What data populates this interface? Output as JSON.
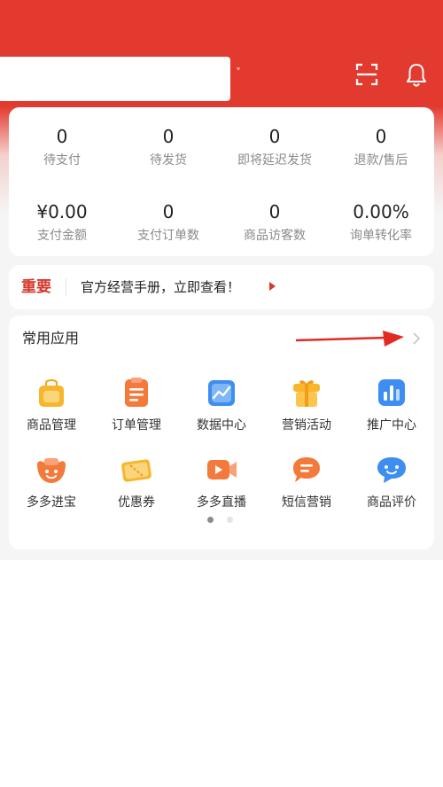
{
  "header": {
    "shop_name": "",
    "caret": "˅"
  },
  "stats": [
    {
      "value": "0",
      "label": "待支付"
    },
    {
      "value": "0",
      "label": "待发货"
    },
    {
      "value": "0",
      "label": "即将延迟发货"
    },
    {
      "value": "0",
      "label": "退款/售后"
    },
    {
      "value": "¥0.00",
      "label": "支付金额"
    },
    {
      "value": "0",
      "label": "支付订单数"
    },
    {
      "value": "0",
      "label": "商品访客数"
    },
    {
      "value": "0.00%",
      "label": "询单转化率"
    }
  ],
  "notice": {
    "tag": "重要",
    "text": "官方经营手册，立即查看！"
  },
  "apps": {
    "title": "常用应用",
    "items": [
      {
        "label": "商品管理",
        "icon": "shopping-bag-icon"
      },
      {
        "label": "订单管理",
        "icon": "order-list-icon"
      },
      {
        "label": "数据中心",
        "icon": "chart-trend-icon"
      },
      {
        "label": "营销活动",
        "icon": "gift-box-icon"
      },
      {
        "label": "推广中心",
        "icon": "bar-chart-icon"
      },
      {
        "label": "多多进宝",
        "icon": "treasure-pot-icon"
      },
      {
        "label": "优惠券",
        "icon": "coupon-icon"
      },
      {
        "label": "多多直播",
        "icon": "live-video-icon"
      },
      {
        "label": "短信营销",
        "icon": "sms-message-icon"
      },
      {
        "label": "商品评价",
        "icon": "review-chat-icon"
      }
    ],
    "page_indicator": {
      "current": 1,
      "total": 2
    }
  },
  "colors": {
    "brand_red": "#e33a2f",
    "notice_red": "#d6392e",
    "orange": "#f47a3c",
    "yellow": "#f8b62d",
    "blue": "#3d8ef0"
  }
}
